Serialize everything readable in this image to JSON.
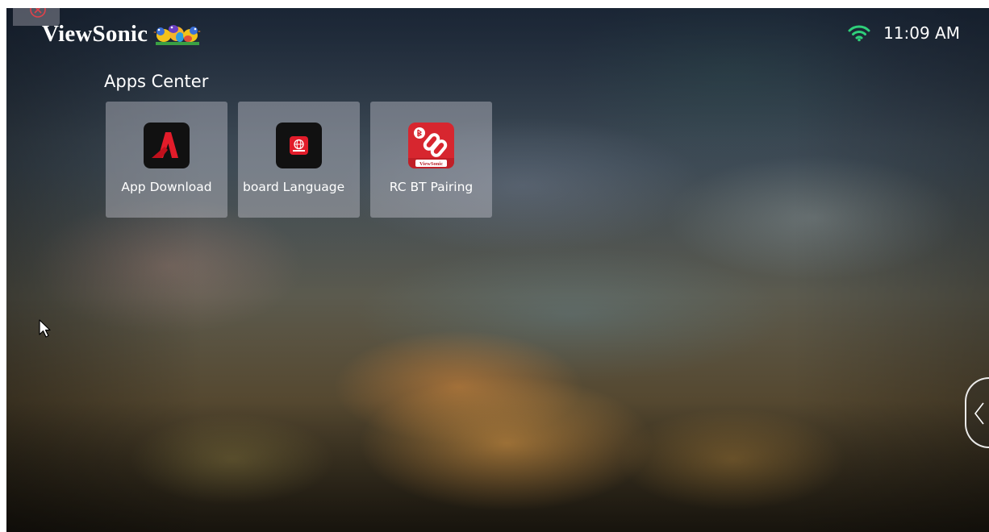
{
  "header": {
    "brand": "ViewSonic",
    "time": "11:09 AM"
  },
  "apps_center": {
    "title": "Apps Center",
    "apps": [
      {
        "label": "App Download",
        "icon": "app-download-icon"
      },
      {
        "label": "board Language",
        "icon": "keyboard-language-icon"
      },
      {
        "label": "RC BT Pairing",
        "icon": "rc-bt-pairing-icon",
        "icon_text": "ViewSonic"
      }
    ]
  },
  "icons": {
    "close": "close-icon",
    "wifi": "wifi-icon",
    "side_handle": "chevron-left-icon",
    "cursor": "mouse-cursor-icon"
  },
  "colors": {
    "wifi": "#2fd07a",
    "close": "#e0424a",
    "app_red": "#e21c2a"
  }
}
